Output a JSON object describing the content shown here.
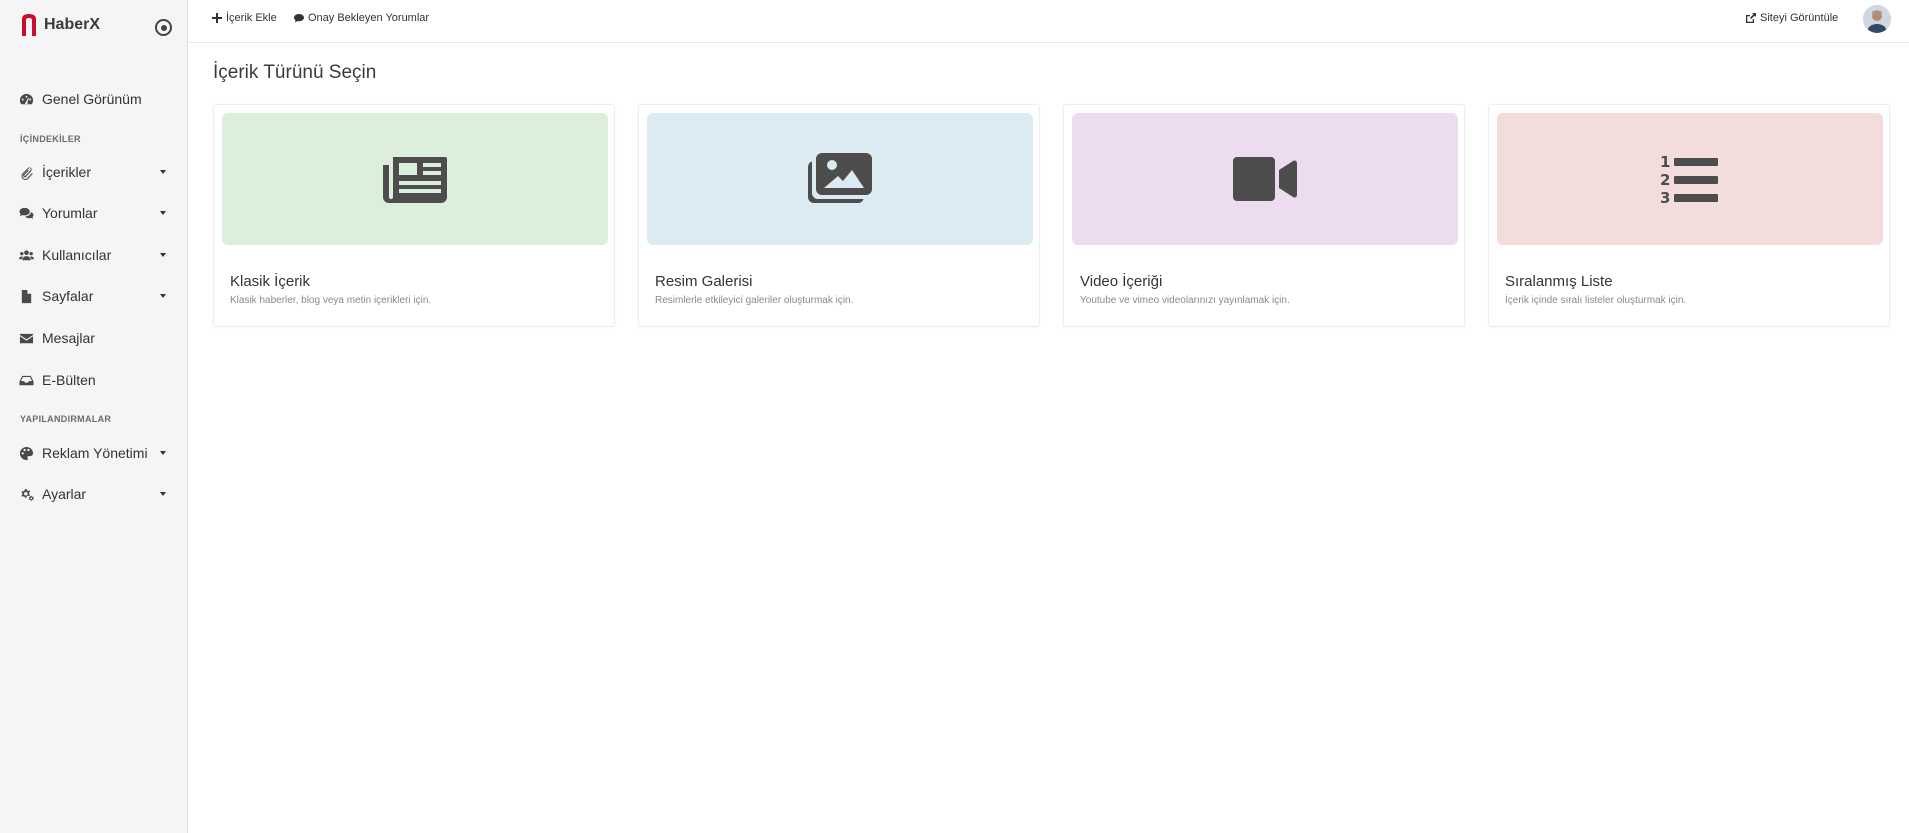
{
  "brand": {
    "name": "HaberX",
    "logo_color": "#c8102e"
  },
  "sidebar": {
    "overview": "Genel Görünüm",
    "section_content": "İÇİNDEKİLER",
    "section_config": "YAPILANDIRMALAR",
    "items": [
      {
        "label": "İçerikler",
        "icon": "paperclip-icon"
      },
      {
        "label": "Yorumlar",
        "icon": "comments-icon"
      },
      {
        "label": "Kullanıcılar",
        "icon": "users-icon"
      },
      {
        "label": "Sayfalar",
        "icon": "file-icon"
      },
      {
        "label": "Mesajlar",
        "icon": "envelope-icon"
      },
      {
        "label": "E-Bülten",
        "icon": "inbox-icon"
      },
      {
        "label": "Reklam Yönetimi",
        "icon": "palette-icon"
      },
      {
        "label": "Ayarlar",
        "icon": "cogs-icon"
      }
    ]
  },
  "topbar": {
    "add_content": "İçerik Ekle",
    "pending_comments": "Onay Bekleyen Yorumlar",
    "view_site": "Siteyi Görüntüle"
  },
  "main": {
    "title": "İçerik Türünü Seçin",
    "cards": [
      {
        "title": "Klasik İçerik",
        "desc": "Klasik haberler, blog veya metin içerikleri için.",
        "bg": "#dcefdc",
        "icon": "newspaper-icon"
      },
      {
        "title": "Resim Galerisi",
        "desc": "Resimlerle etkileyici galeriler oluşturmak için.",
        "bg": "#dcebf2",
        "icon": "images-icon"
      },
      {
        "title": "Video İçeriği",
        "desc": "Youtube ve vimeo videolarınızı yayınlamak için.",
        "bg": "#eddcef",
        "icon": "video-icon"
      },
      {
        "title": "Sıralanmış Liste",
        "desc": "İçerik içinde sıralı listeler oluşturmak için.",
        "bg": "#f2dcdc",
        "icon": "list-ol-icon"
      }
    ]
  }
}
